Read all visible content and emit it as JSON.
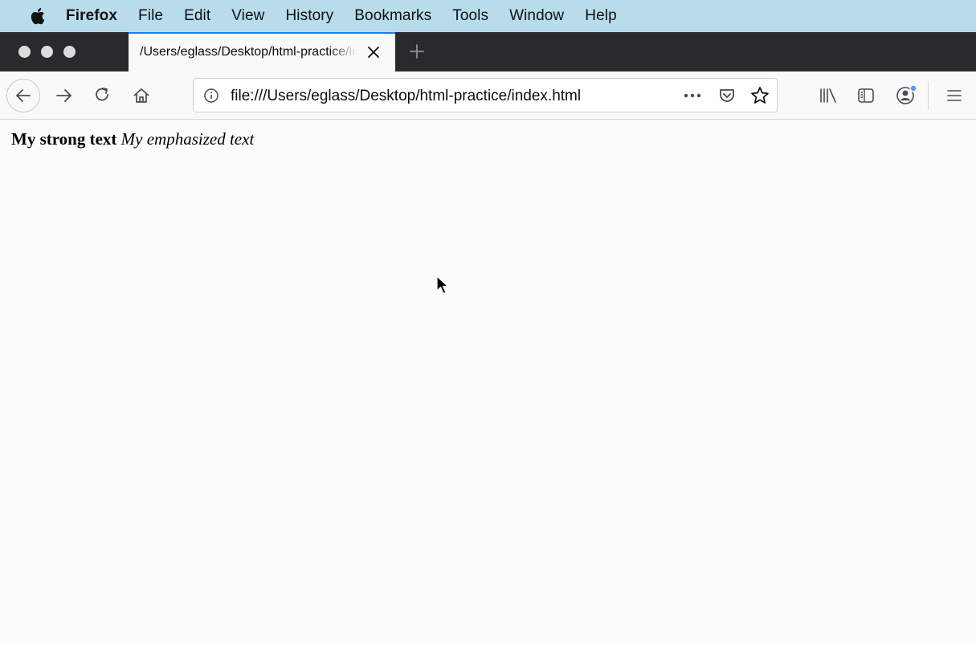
{
  "menubar": {
    "app_name": "Firefox",
    "items": [
      "File",
      "Edit",
      "View",
      "History",
      "Bookmarks",
      "Tools",
      "Window",
      "Help"
    ]
  },
  "tab": {
    "title": "/Users/eglass/Desktop/html-practice/index.html"
  },
  "urlbar": {
    "url": "file:///Users/eglass/Desktop/html-practice/index.html"
  },
  "icons": {
    "apple": "apple-logo-icon",
    "close_tab": "close-icon",
    "new_tab": "plus-icon",
    "back": "back-arrow-icon",
    "forward": "forward-arrow-icon",
    "reload": "reload-icon",
    "home": "home-icon",
    "info": "info-icon",
    "page_actions": "ellipsis-icon",
    "pocket": "pocket-icon",
    "bookmark": "star-icon",
    "library": "library-icon",
    "sidebar": "sidebar-icon",
    "account": "account-icon",
    "menu": "hamburger-menu-icon"
  },
  "colors": {
    "menubar_bg": "#b8dcec",
    "tabstrip_bg": "#2a2a2e",
    "tab_accent": "#0a84ff",
    "toolbar_bg": "#f9f9fa"
  },
  "page": {
    "strong_text": "My strong text",
    "emphasized_text": "My emphasized text"
  }
}
